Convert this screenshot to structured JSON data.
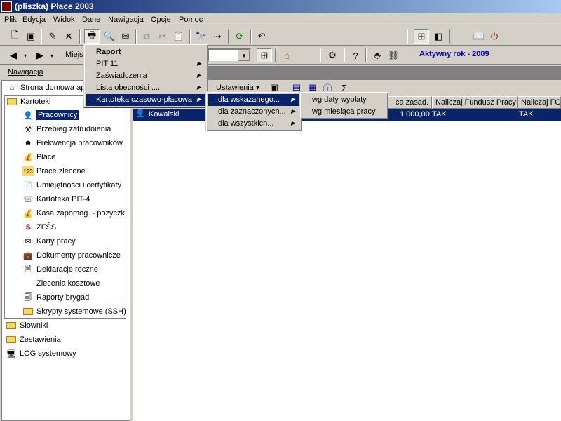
{
  "window": {
    "title": "(pliszka)  Płace 2003"
  },
  "menubar": [
    "Plik",
    "Edycja",
    "Widok",
    "Dane",
    "Nawigacja",
    "Opcje",
    "Pomoc"
  ],
  "toolbar2": {
    "address_label": "Miejs",
    "active_year": "Aktywny rok - 2009"
  },
  "navigation": {
    "header": "Nawigacja",
    "home": "Strona domowa ap",
    "kartoteki": "Kartoteki",
    "items": [
      "Pracownicy",
      "Przebieg zatrudnienia",
      "Frekwencja pracowników",
      "Płace",
      "Prace zlecone",
      "Umiejętności i certyfikaty",
      "Kartoteka PIT-4",
      "Kasa zapomog. - pożyczk.",
      "ZFŚS",
      "Karty pracy",
      "Dokumenty pracownicze",
      "Deklaracje roczne",
      "Zlecenia kosztowe",
      "Raporty brygad",
      "Skrypty systemowe (SSH)"
    ],
    "bottom": [
      "Słowniki",
      "Zestawienia",
      "LOG systemowy"
    ]
  },
  "right_toolbar": {
    "settings_label": "Ustawienia",
    "sigma": "Σ"
  },
  "grid": {
    "headers": [
      "ca zasad.",
      "Naliczaj Fundusz Pracy",
      "Naliczaj FGŚ"
    ],
    "row": {
      "name": "Kowalski",
      "salary": "1 000,00",
      "fp": "TAK",
      "fgs": "TAK"
    }
  },
  "menu_raport": {
    "title": "Raport",
    "items": [
      "PIT 11",
      "Zaświadczenia",
      "Lista obecności ....",
      "Kartoteka czasowo-płacowa"
    ]
  },
  "submenu_kartoteka": [
    "dla wskazanego...",
    "dla zaznaczonych...",
    "dla wszystkich..."
  ],
  "submenu_wskazanego": [
    "wg daty wypłaty",
    "wg miesiąca pracy"
  ]
}
